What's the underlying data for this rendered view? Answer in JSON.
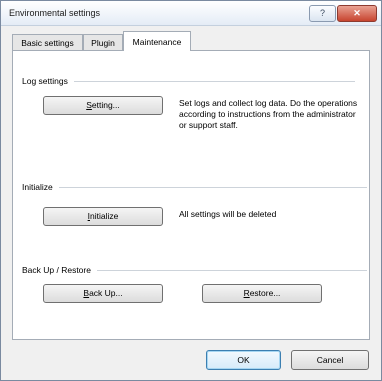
{
  "window": {
    "title": "Environmental settings",
    "help_glyph": "?",
    "close_glyph": "✕"
  },
  "tabs": [
    {
      "label": "Basic settings"
    },
    {
      "label": "Plugin"
    },
    {
      "label": "Maintenance",
      "active": true
    }
  ],
  "log": {
    "group": "Log settings",
    "button_pre": "",
    "button_ul": "S",
    "button_post": "etting...",
    "description": "Set logs and collect log data. Do the operations according to instructions from the administrator or support staff."
  },
  "init": {
    "group": "Initialize",
    "button_pre": "",
    "button_ul": "I",
    "button_post": "nitialize",
    "description": "All settings will be deleted"
  },
  "backup": {
    "group": "Back Up / Restore",
    "backup_pre": "",
    "backup_ul": "B",
    "backup_post": "ack Up...",
    "restore_pre": "",
    "restore_ul": "R",
    "restore_post": "estore..."
  },
  "footer": {
    "ok": "OK",
    "cancel": "Cancel"
  }
}
